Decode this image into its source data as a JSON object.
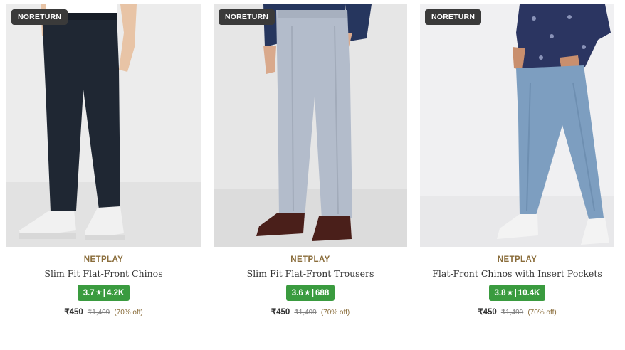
{
  "products": [
    {
      "badge": "NORETURN",
      "brand": "NETPLAY",
      "title": "Slim Fit Flat-Front Chinos",
      "rating": "3.7",
      "rating_count": "4.2K",
      "price": "₹450",
      "mrp": "₹1,499",
      "discount": "(70% off)",
      "colors": {
        "pant": "#1f2733",
        "bg": "#ececec",
        "shoe": "#f1f1f1"
      }
    },
    {
      "badge": "NORETURN",
      "brand": "NETPLAY",
      "title": "Slim Fit Flat-Front Trousers",
      "rating": "3.6",
      "rating_count": "688",
      "price": "₹450",
      "mrp": "₹1,499",
      "discount": "(70% off)",
      "colors": {
        "pant": "#b3bccb",
        "bg": "#e6e6e6",
        "shoe": "#4a1f1a",
        "shirt": "#26365e"
      }
    },
    {
      "badge": "NORETURN",
      "brand": "NETPLAY",
      "title": "Flat-Front Chinos with Insert Pockets",
      "rating": "3.8",
      "rating_count": "10.4K",
      "price": "₹450",
      "mrp": "₹1,499",
      "discount": "(70% off)",
      "colors": {
        "pant": "#7d9ec0",
        "bg": "#f0f0f2",
        "shoe": "#f3f3f3",
        "shirt": "#2b3561"
      }
    }
  ],
  "rating_separator": "|",
  "star_glyph": "★",
  "accent": {
    "brand_text": "#8a6d3b",
    "rating_bg": "#3a9b3f",
    "badge_bg": "#3a3a3a"
  }
}
